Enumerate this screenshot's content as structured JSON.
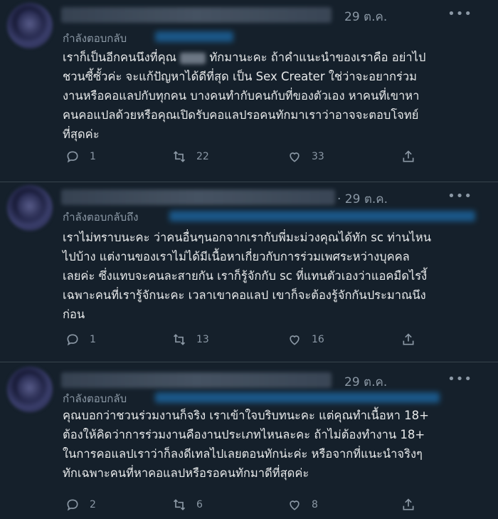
{
  "tweets": [
    {
      "time": "29 ต.ค.",
      "reply_label": "กำลังตอบกลับ",
      "lines": [
        [
          "เราก็เป็นอีกคนนึงที่คุณ ",
          "ทักมานะคะ ถ้าคำแนะนำของเราคือ อย่าไป"
        ],
        "ชวนซี้ซั้วค่ะ จะแก้ปัญหาได้ดีที่สุด เป็น Sex Creater ใช่ว่าจะอยากร่วม",
        "งานหรือคอแลปกับทุกคน บางคนทำกับคนกับที่ของตัวเอง หาคนที่เขาหา",
        "คนคอแปลด้วยหรือคุณเปิดรับคอแลปรอคนทักมาเราว่าอาจจะตอบโจทย์",
        "ที่สุดค่ะ"
      ],
      "reply_count": "1",
      "retweet_count": "22",
      "like_count": "33"
    },
    {
      "time": "· 29 ต.ค.",
      "reply_label": "กำลังตอบกลับถึง",
      "lines": [
        "เราไม่ทราบนะคะ ว่าคนอื่นๆนอกจากเรากับพี่มะม่วงคุณได้ทัก sc ท่านไหน",
        "ไปบ้าง แต่งานของเราไม่ได้มีเนื้อหาเกี่ยวกับการร่วมเพศระหว่างบุคคล",
        "เลยค่ะ ซึ่งแทบจะคนละสายกัน เราก็รู้จักกับ sc ที่แทนตัวเองว่าแอคมืดไรงี้",
        "เฉพาะคนที่เรารู้จักนะคะ เวลาเขาคอแลป เขาก็จะต้องรู้จักกันประมาณนึง",
        "ก่อน"
      ],
      "reply_count": "1",
      "retweet_count": "13",
      "like_count": "16"
    },
    {
      "time": "29 ต.ค.",
      "reply_label": "กำลังตอบกลับ",
      "lines": [
        "คุณบอกว่าชวนร่วมงานก็จริง เราเข้าใจบริบทนะคะ แต่คุณทำเนื้อหา 18+",
        "ต้องให้คิดว่าการร่วมงานคืองานประเภทไหนละคะ ถ้าไม่ต้องทำงาน 18+",
        "ในการคอแลปเราว่าก็ลงดีเทลไปเลยตอนทักน่ะค่ะ หรือจากที่แนะนำจริงๆ",
        "ทักเฉพาะคนที่หาคอแลปหรือรอคนทักมาดีที่สุดค่ะ"
      ],
      "reply_count": "2",
      "retweet_count": "6",
      "like_count": "8"
    }
  ],
  "icons": {
    "reply": "reply-icon",
    "retweet": "retweet-icon",
    "like": "heart-icon",
    "share": "share-icon",
    "more": "more-icon"
  },
  "colors": {
    "background": "#15202b",
    "text": "#e7e9ea",
    "muted": "#8b98a5",
    "divider": "#38444d"
  }
}
